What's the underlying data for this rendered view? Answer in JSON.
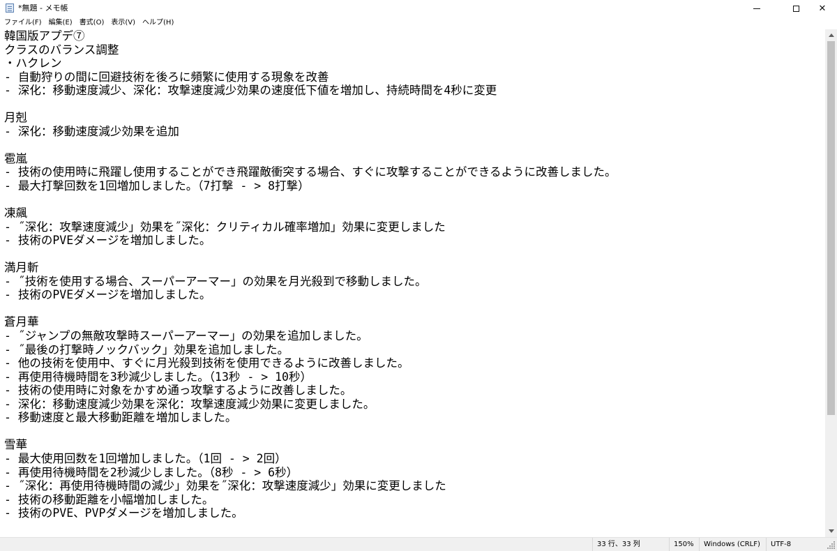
{
  "window": {
    "title": "*無題 - メモ帳",
    "controls": {
      "minimize": "minimize-icon",
      "maximize": "maximize-icon",
      "close": "✕"
    }
  },
  "menu": {
    "file": "ファイル(F)",
    "edit": "編集(E)",
    "format": "書式(O)",
    "view": "表示(V)",
    "help": "ヘルプ(H)"
  },
  "editor": {
    "content": "韓国版アプデ⑦\nクラスのバランス調整\n・ハクレン\n- 自動狩りの間に回避技術を後ろに頻繁に使用する現象を改善\n- 深化：移動速度減少、深化：攻撃速度減少効果の速度低下値を増加し、持続時間を4秒に変更\n\n月剋\n- 深化：移動速度減少効果を追加\n\n雹嵐\n- 技術の使用時に飛躍し使用することができ飛躍敵衝突する場合、すぐに攻撃することができるように改善しました。\n- 最大打撃回数を1回増加しました。（7打撃 - > 8打撃）\n\n凍飆\n- ˝深化：攻撃速度減少」効果を˝深化：クリティカル確率増加」効果に変更しました\n- 技術のPVEダメージを増加しました。\n\n満月斬\n- ˝技術を使用する場合、スーパーアーマー」の効果を月光殺到で移動しました。\n- 技術のPVEダメージを増加しました。\n\n蒼月華\n- ˝ジャンプの無敵攻撃時スーパーアーマー」の効果を追加しました。\n- ˝最後の打撃時ノックバック」効果を追加しました。\n- 他の技術を使用中、すぐに月光殺到技術を使用できるように改善しました。\n- 再使用待機時間を3秒減少しました。（13秒 - > 10秒）\n- 技術の使用時に対象をかすめ通っ攻撃するように改善しました。\n- 深化：移動速度減少効果を深化：攻撃速度減少効果に変更しました。\n- 移動速度と最大移動距離を増加しました。\n\n雪華\n- 最大使用回数を1回増加しました。（1回 - > 2回）\n- 再使用待機時間を2秒減少しました。（8秒 - > 6秒）\n- ˝深化：再使用待機時間の減少」効果を˝深化：攻撃速度減少」効果に変更しました\n- 技術の移動距離を小幅増加しました。\n- 技術のPVE、PVPダメージを増加しました。"
  },
  "status": {
    "position": "33 行、33 列",
    "zoom": "150%",
    "line_ending": "Windows (CRLF)",
    "encoding": "UTF-8"
  },
  "colors": {
    "background": "#ffffff",
    "chrome": "#f0f0f0",
    "scroll_thumb": "#c1c1c1",
    "text": "#000000"
  }
}
